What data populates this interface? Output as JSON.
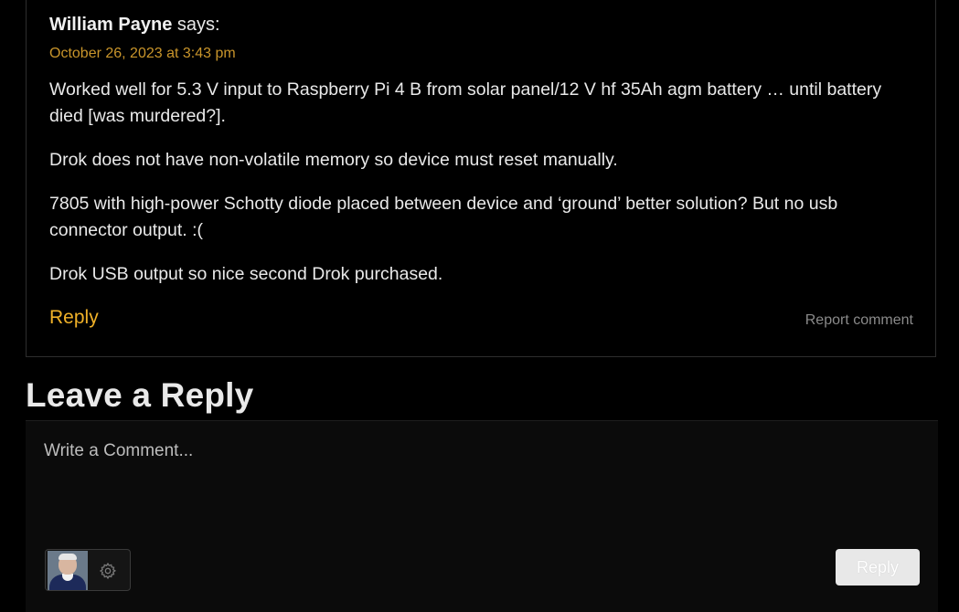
{
  "comment": {
    "author": "William Payne",
    "says": "says:",
    "date": "October 26, 2023 at 3:43 pm",
    "paragraphs": [
      "Worked well for 5.3 V input to Raspberry Pi 4 B from solar panel/12 V hf 35Ah agm battery … until battery died [was murdered?].",
      "Drok does not have non-volatile memory so device must reset manually.",
      "7805 with high-power Schotty diode placed between device and ‘ground’ better solution? But no usb connector output. :(",
      "Drok USB output so nice second Drok purchased."
    ],
    "reply_label": "Reply",
    "report_label": "Report comment"
  },
  "reply_form": {
    "title": "Leave a Reply",
    "placeholder": "Write a Comment...",
    "value": "",
    "submit_label": "Reply",
    "settings_icon": "gear-icon"
  },
  "colors": {
    "background": "#000000",
    "accent": "#f0b128",
    "date": "#c9952b",
    "muted": "#8a8a8a",
    "text": "#e9e9e9"
  }
}
